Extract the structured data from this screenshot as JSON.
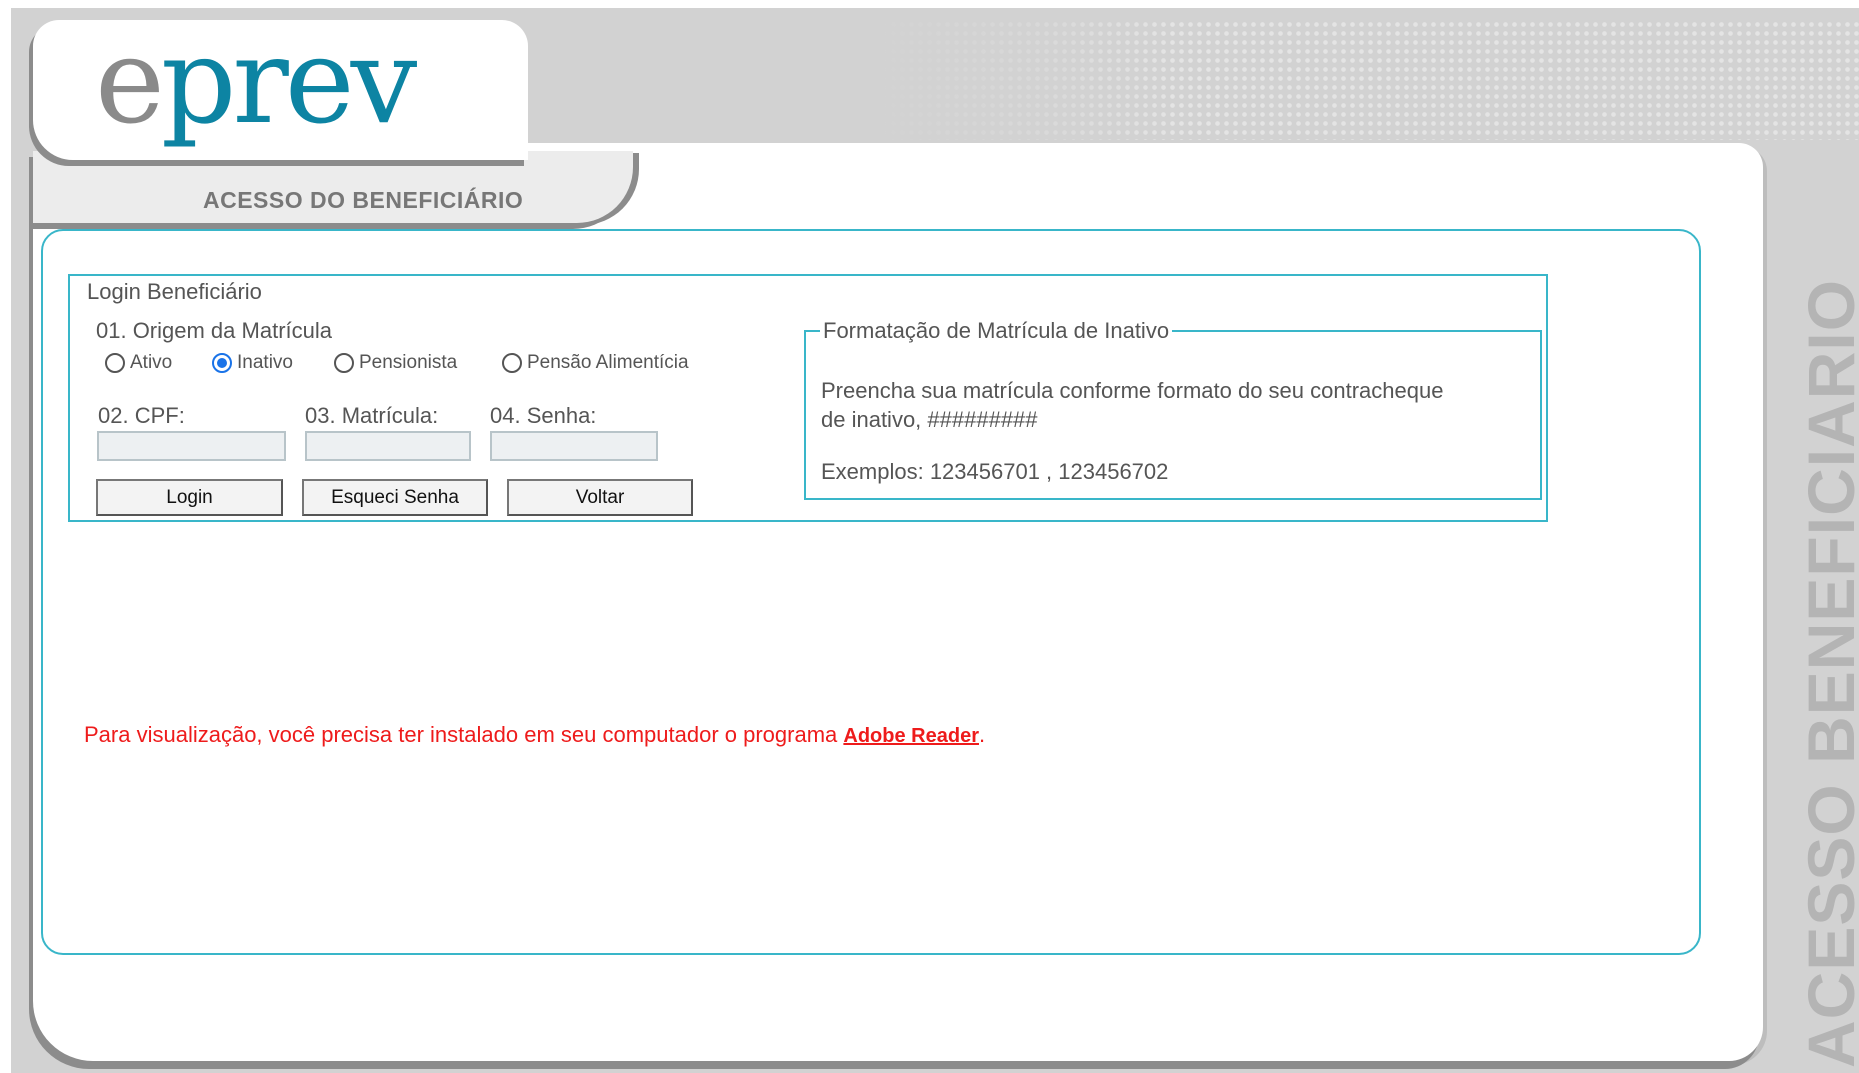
{
  "brand": {
    "logo_text_e": "e",
    "logo_text_rest": "prev"
  },
  "header": {
    "page_title": "ACESSO DO BENEFICIÁRIO"
  },
  "side_title": "ACESSO BENEFICIARIO",
  "login": {
    "legend": "Login Beneficiário",
    "origin_label": "01. Origem da Matrícula",
    "radios": [
      {
        "label": "Ativo",
        "checked": false
      },
      {
        "label": "Inativo",
        "checked": true
      },
      {
        "label": "Pensionista",
        "checked": false
      },
      {
        "label": "Pensão Alimentícia",
        "checked": false
      }
    ],
    "cpf_label": "02. CPF:",
    "cpf_value": "",
    "matricula_label": "03. Matrícula:",
    "matricula_value": "",
    "senha_label": "04. Senha:",
    "senha_value": "",
    "buttons": {
      "login": "Login",
      "forgot": "Esqueci Senha",
      "back": "Voltar"
    }
  },
  "format_box": {
    "legend": "Formatação de Matrícula de Inativo",
    "line1": "Preencha sua matrícula conforme formato do seu contracheque",
    "line2": "de inativo, #########",
    "examples": "Exemplos: 123456701 , 123456702"
  },
  "notice": {
    "text": "Para visualização, você precisa ter instalado em seu computador o programa ",
    "link": "Adobe Reader",
    "suffix": "."
  },
  "colors": {
    "accent": "#39b6c9",
    "brand": "#0d84a3",
    "notice": "#ee1b1b",
    "radio_checked": "#1a73e8"
  }
}
